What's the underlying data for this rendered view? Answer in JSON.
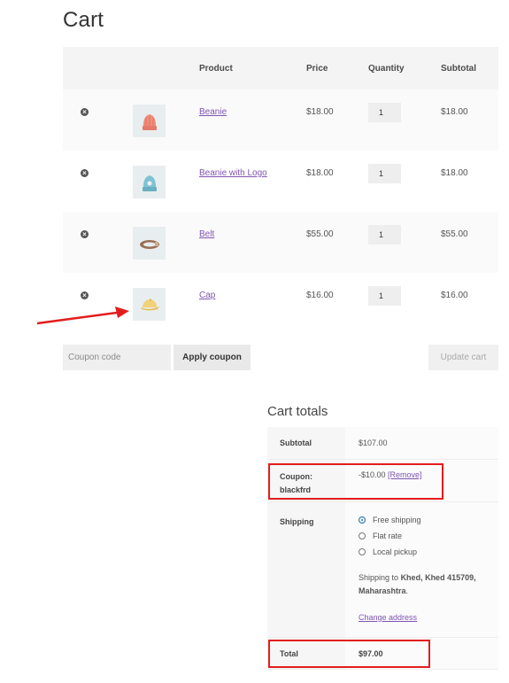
{
  "page": {
    "title": "Cart"
  },
  "cart": {
    "headers": {
      "product": "Product",
      "price": "Price",
      "quantity": "Quantity",
      "subtotal": "Subtotal"
    },
    "items": [
      {
        "name": "Beanie",
        "price": "$18.00",
        "quantity": "1",
        "subtotal": "$18.00",
        "thumb_icon": "beanie-icon"
      },
      {
        "name": "Beanie with Logo",
        "price": "$18.00",
        "quantity": "1",
        "subtotal": "$18.00",
        "thumb_icon": "beanie-logo-icon"
      },
      {
        "name": "Belt",
        "price": "$55.00",
        "quantity": "1",
        "subtotal": "$55.00",
        "thumb_icon": "belt-icon"
      },
      {
        "name": "Cap",
        "price": "$16.00",
        "quantity": "1",
        "subtotal": "$16.00",
        "thumb_icon": "cap-icon"
      }
    ],
    "remove_icon": "×"
  },
  "actions": {
    "coupon_placeholder": "Coupon code",
    "apply_coupon": "Apply coupon",
    "update_cart": "Update cart"
  },
  "totals": {
    "title": "Cart totals",
    "subtotal_label": "Subtotal",
    "subtotal_value": "$107.00",
    "coupon_label_1": "Coupon:",
    "coupon_label_2": "blackfrd",
    "coupon_value": "-$10.00",
    "coupon_remove": "[Remove]",
    "shipping_label": "Shipping",
    "shipping_options": [
      "Free shipping",
      "Flat rate",
      "Local pickup"
    ],
    "shipping_selected": "Free shipping",
    "shipping_to_prefix": "Shipping to",
    "shipping_to_address_1": "Khed, Khed 415709,",
    "shipping_to_address_2": "Maharashtra",
    "shipping_to_suffix": ".",
    "change_address": "Change address",
    "total_label": "Total",
    "total_value": "$97.00"
  },
  "colors": {
    "link": "#7f54b3",
    "annotation": "#e31d1d",
    "radio_checked": "#2271b1"
  }
}
